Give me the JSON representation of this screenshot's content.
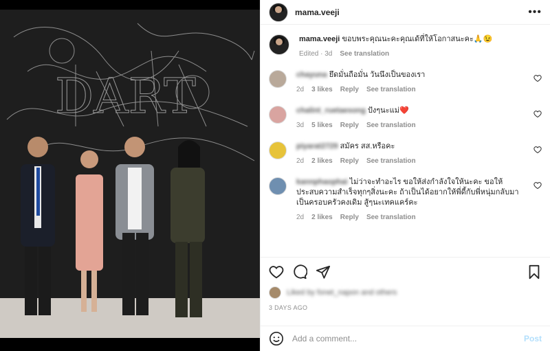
{
  "header": {
    "username": "mama.veeji",
    "more_icon": "more-horizontal-icon"
  },
  "caption": {
    "username": "mama.veeji",
    "text": "ขอบพระคุณนะคะคุณเด้ที่ให้โอกาสนะคะ🙏😉",
    "edited": "Edited · 3d",
    "see_translation": "See translation"
  },
  "comments": [
    {
      "username": "chayuna",
      "text": "ยึดมั่นถือมั่น วันนึงเป็นของเรา",
      "time": "2d",
      "likes": "3 likes",
      "reply": "Reply",
      "see_translation": "See translation",
      "avatar_color": "#b9a99a"
    },
    {
      "username": "chalint_ruetaesong",
      "text": "ปังๆนะแม่❤️",
      "time": "3d",
      "likes": "5 likes",
      "reply": "Reply",
      "see_translation": "See translation",
      "avatar_color": "#d9a4a0"
    },
    {
      "username": "piyarat2729",
      "text": "สมัคร สส.หรือคะ",
      "time": "2d",
      "likes": "2 likes",
      "reply": "Reply",
      "see_translation": "See translation",
      "avatar_color": "#e7c33a"
    },
    {
      "username": "kannphaophai",
      "text": "ไม่ว่าจะทำอะไร ขอให้ส่งกำลังใจให้นะคะ ขอให้ประสบความสำเร็จทุกๆสิ่งนะคะ ถ้าเป็นได้อยากให้พี่ดี้กับพี่หนุ่มกลับมาเป็นครอบครัวคงเดิม สู้ๆนะเทคแคร์คะ",
      "time": "2d",
      "likes": "2 likes",
      "reply": "Reply",
      "see_translation": "See translation",
      "avatar_color": "#6f8fb0"
    }
  ],
  "actions": {
    "like_icon": "heart-icon",
    "comment_icon": "comment-icon",
    "share_icon": "share-icon",
    "save_icon": "bookmark-icon",
    "liked_by": "Liked by fonet_napon and others",
    "date": "3 DAYS AGO"
  },
  "add_comment": {
    "placeholder": "Add a comment...",
    "post_label": "Post",
    "emoji_icon": "emoji-icon"
  }
}
